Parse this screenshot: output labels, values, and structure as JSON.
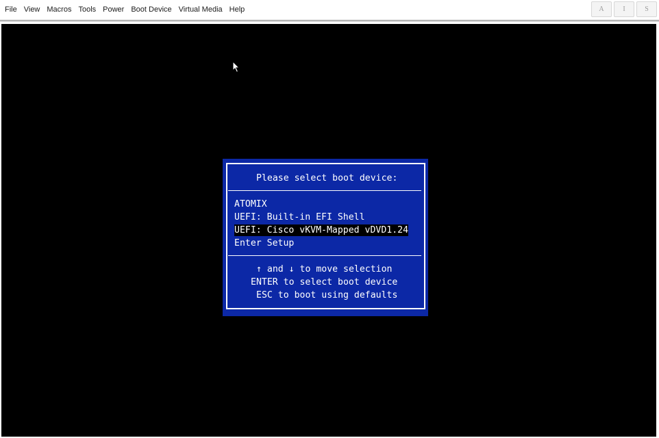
{
  "menu": {
    "items": [
      {
        "label": "File"
      },
      {
        "label": "View"
      },
      {
        "label": "Macros"
      },
      {
        "label": "Tools"
      },
      {
        "label": "Power"
      },
      {
        "label": "Boot Device"
      },
      {
        "label": "Virtual Media"
      },
      {
        "label": "Help"
      }
    ]
  },
  "toolbar": {
    "buttons": [
      {
        "label": "A"
      },
      {
        "label": "I"
      },
      {
        "label": "S"
      }
    ]
  },
  "boot_menu": {
    "title": "Please select boot device:",
    "options": [
      {
        "label": "ATOMIX"
      },
      {
        "label": "UEFI: Built-in EFI Shell"
      },
      {
        "label": "UEFI: Cisco vKVM-Mapped vDVD1.24"
      },
      {
        "label": "Enter Setup"
      }
    ],
    "selected_index": 2,
    "help": {
      "line1": "↑ and ↓ to move selection",
      "line2": "ENTER to select boot device",
      "line3": "ESC to boot using defaults"
    }
  },
  "colors": {
    "dialog_bg": "#0c28a6",
    "screen_bg": "#000000",
    "text": "#ffffff",
    "selection_bg": "#000000"
  },
  "icons": {
    "cursor": "mouse-pointer-icon"
  }
}
